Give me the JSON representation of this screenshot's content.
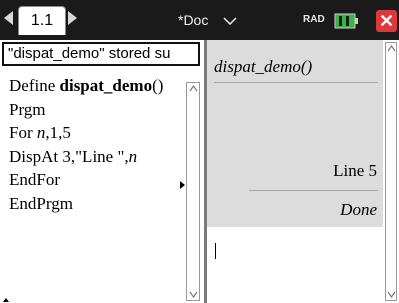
{
  "titlebar": {
    "tab_label": "1.1",
    "doc_name": "*Doc",
    "angle_mode": "RAD",
    "colors": {
      "bar": "#1a1a1a",
      "close": "#d9393a",
      "battery": "#3bb34a"
    }
  },
  "editor": {
    "status_message": "\"dispat_demo\" stored su",
    "code": {
      "line1_keyword": "Define ",
      "line1_name": "dispat_demo",
      "line1_parens": "()",
      "line2": "Prgm",
      "line3_keyword": "For ",
      "line3_var": "n",
      "line3_rest": ",1,5",
      "line4_text": "DispAt 3,\"Line \",",
      "line4_var": "n",
      "line5": "EndFor",
      "line6": "EndPrgm"
    }
  },
  "calculator": {
    "entry": "dispat_demo()",
    "output_line": "Line 5",
    "output_result": "Done"
  }
}
